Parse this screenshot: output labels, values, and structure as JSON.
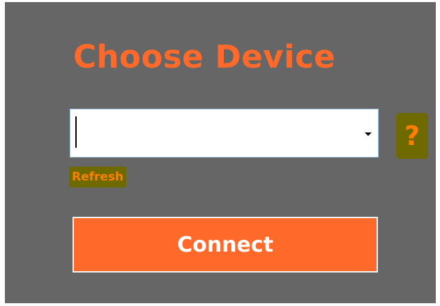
{
  "dialog": {
    "title": "Choose Device",
    "device_select": {
      "value": "",
      "placeholder": ""
    },
    "help_label": "?",
    "refresh_label": "Refresh",
    "connect_label": "Connect"
  },
  "colors": {
    "accent": "#ff6a2a",
    "panel_bg": "#666666",
    "highlight": "#6e6a00",
    "link_text": "#ff7f00"
  },
  "icons": {
    "dropdown": "chevron-down-icon",
    "help": "help-icon"
  }
}
